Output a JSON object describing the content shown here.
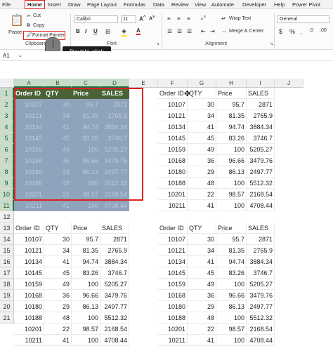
{
  "menu": [
    "File",
    "Home",
    "Insert",
    "Draw",
    "Page Layout",
    "Formulas",
    "Data",
    "Review",
    "View",
    "Automate",
    "Developer",
    "Help",
    "Power Pivot"
  ],
  "ribbon": {
    "paste": "Paste",
    "cut": "Cut",
    "copy": "Copy",
    "format_painter": "Format Painter",
    "font_name": "Calibri",
    "font_size": "11",
    "wrap_text": "Wrap Text",
    "merge_center": "Merge & Center",
    "number_format": "General",
    "groups": {
      "clipboard": "Clipboard",
      "font": "Font",
      "alignment": "Alignment"
    }
  },
  "tooltip": "Double-click",
  "name_box": "A1",
  "columns": [
    "A",
    "B",
    "C",
    "D",
    "E",
    "F",
    "G",
    "H",
    "I",
    "J"
  ],
  "rows": [
    "1",
    "2",
    "3",
    "4",
    "5",
    "6",
    "7",
    "8",
    "9",
    "10",
    "11",
    "12",
    "13",
    "14",
    "15",
    "16",
    "17",
    "18",
    "19",
    "20",
    "21"
  ],
  "table_headers": [
    "Order ID",
    "QTY",
    "Price",
    "SALES"
  ],
  "table_rows": [
    [
      "10107",
      "30",
      "95.7",
      "2871"
    ],
    [
      "10121",
      "34",
      "81.35",
      "2765.9"
    ],
    [
      "10134",
      "41",
      "94.74",
      "3884.34"
    ],
    [
      "10145",
      "45",
      "83.26",
      "3746.7"
    ],
    [
      "10159",
      "49",
      "100",
      "5205.27"
    ],
    [
      "10168",
      "36",
      "96.66",
      "3479.76"
    ],
    [
      "10180",
      "29",
      "86.13",
      "2497.77"
    ],
    [
      "10188",
      "48",
      "100",
      "5512.32"
    ],
    [
      "10201",
      "22",
      "98.57",
      "2168.54"
    ],
    [
      "10211",
      "41",
      "100",
      "4708.44"
    ]
  ],
  "colors": {
    "accent_red": "#e02020",
    "excel_green": "#217346",
    "header_fill": "#4a6336",
    "selection_fill": "#8ea3bc"
  }
}
